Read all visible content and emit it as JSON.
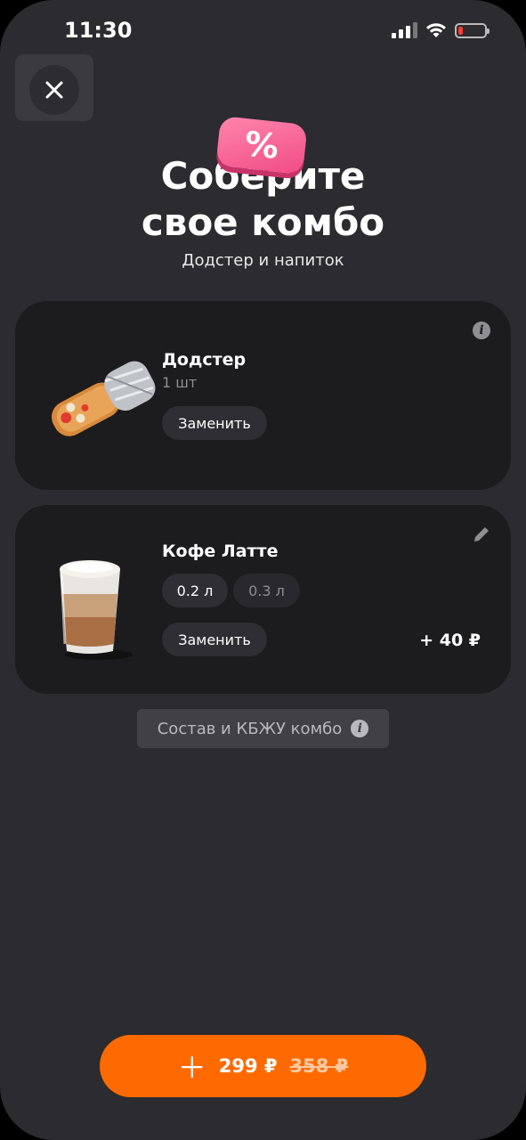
{
  "status": {
    "time": "11:30"
  },
  "header": {
    "discount_badge": "%",
    "title_line1": "Соберите",
    "title_line2": "свое комбо",
    "subtitle": "Додстер и напиток"
  },
  "items": [
    {
      "name": "Додстер",
      "quantity": "1 шт",
      "replace_label": "Заменить",
      "corner_icon": "info-icon"
    },
    {
      "name": "Кофе Латте",
      "sizes": [
        "0.2 л",
        "0.3 л"
      ],
      "selected_size": "0.2 л",
      "replace_label": "Заменить",
      "surcharge": "+ 40 ₽",
      "corner_icon": "pencil-icon"
    }
  ],
  "composition_button": "Состав и КБЖУ комбо",
  "cta": {
    "price": "299 ₽",
    "old_price": "358 ₽"
  },
  "colors": {
    "background": "#2b2b30",
    "card": "#1c1c1f",
    "accent": "#ff6a00",
    "badge": "#f04c85"
  }
}
